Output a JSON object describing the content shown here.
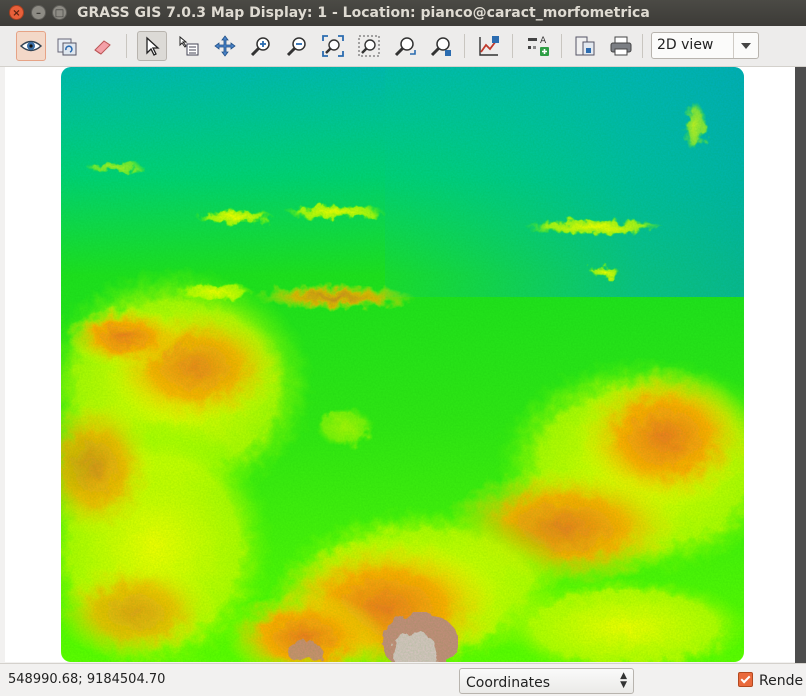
{
  "window": {
    "title": "GRASS GIS 7.0.3 Map Display: 1  - Location: pianco@caract_morfometrica",
    "buttons": [
      "close-icon",
      "minimize-icon",
      "maximize-icon"
    ]
  },
  "toolbar": {
    "tools": [
      {
        "name": "display-map",
        "icon": "eye-icon",
        "state": "active"
      },
      {
        "name": "render-map",
        "icon": "render-map-icon"
      },
      {
        "name": "erase-display",
        "icon": "eraser-icon"
      },
      {
        "name": "pointer",
        "icon": "pointer-icon",
        "state": "pressed"
      },
      {
        "name": "query",
        "icon": "query-icon"
      },
      {
        "name": "pan",
        "icon": "pan-icon"
      },
      {
        "name": "zoom-in",
        "icon": "zoom-in-icon"
      },
      {
        "name": "zoom-out",
        "icon": "zoom-out-icon"
      },
      {
        "name": "zoom-extent",
        "icon": "zoom-extent-icon"
      },
      {
        "name": "zoom-region",
        "icon": "zoom-region-icon"
      },
      {
        "name": "zoom-back",
        "icon": "zoom-back-icon"
      },
      {
        "name": "zoom-options",
        "icon": "zoom-options-icon"
      },
      {
        "name": "analyze",
        "icon": "analyze-icon"
      },
      {
        "name": "map-elements",
        "icon": "map-elements-icon"
      },
      {
        "name": "save",
        "icon": "save-icon"
      },
      {
        "name": "print",
        "icon": "print-icon"
      }
    ],
    "view_select": "2D view"
  },
  "map": {
    "layer": "elevation raster",
    "colors": [
      "#00b9b6",
      "#1ee21f",
      "#5dff00",
      "#e8ff00",
      "#ffd400",
      "#ff9a00",
      "#f07d1e",
      "#c58d7b",
      "#ffffff"
    ]
  },
  "statusbar": {
    "coordinates": "548990.68; 9184504.70",
    "mode": "Coordinates",
    "render_label": "Rende"
  }
}
